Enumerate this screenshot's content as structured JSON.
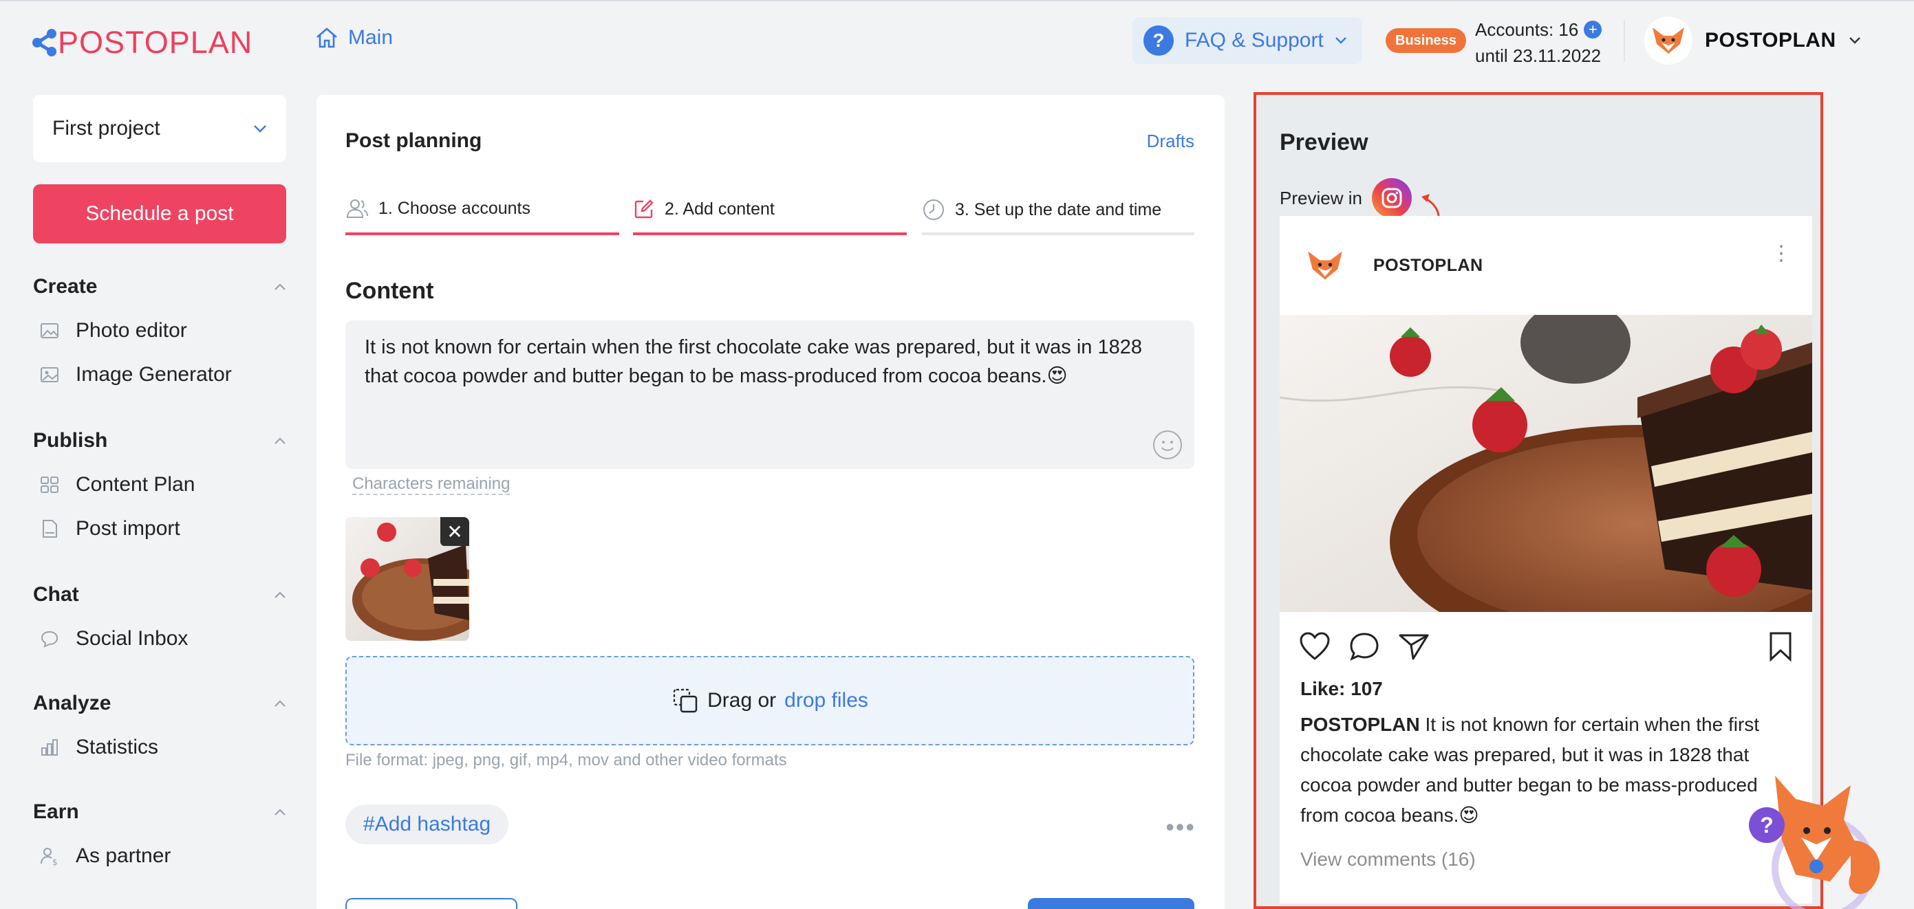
{
  "header": {
    "logo": "POSTOPLAN",
    "main_link": "Main",
    "faq": "FAQ & Support",
    "badge": "Business",
    "accounts_label": "Accounts: 16",
    "accounts_until": "until 23.11.2022",
    "user_name": "POSTOPLAN"
  },
  "sidebar": {
    "project": "First project",
    "schedule_button": "Schedule a post",
    "sections": [
      {
        "title": "Create",
        "items": [
          "Photo editor",
          "Image Generator"
        ]
      },
      {
        "title": "Publish",
        "items": [
          "Content Plan",
          "Post import"
        ]
      },
      {
        "title": "Chat",
        "items": [
          "Social Inbox"
        ]
      },
      {
        "title": "Analyze",
        "items": [
          "Statistics"
        ]
      },
      {
        "title": "Earn",
        "items": [
          "As partner"
        ]
      }
    ]
  },
  "planner": {
    "title": "Post planning",
    "drafts": "Drafts",
    "steps": [
      "1. Choose accounts",
      "2. Add content",
      "3. Set up the date and time"
    ],
    "content_title": "Content",
    "text": "It is not known for certain when the first chocolate cake was prepared, but it was in 1828 that cocoa powder and butter began to be mass-produced from cocoa beans.😍",
    "chars_remaining": "Characters remaining",
    "drop_text": "Drag or",
    "drop_link": "drop files",
    "formats": "File format: jpeg, png, gif, mp4, mov and other video formats",
    "hashtag": "#Add hashtag"
  },
  "preview": {
    "title": "Preview",
    "preview_in": "Preview in",
    "account": "POSTOPLAN",
    "likes": "Like: 107",
    "caption_user": "POSTOPLAN",
    "caption_text": " It is not known for certain when the first chocolate cake was prepared, but it was in 1828 that cocoa powder and butter began to be mass-produced from cocoa beans.😍",
    "view_comments": "View comments (16)"
  },
  "colors": {
    "brand": "#ee3f5d",
    "accent": "#3b7ae0",
    "highlight": "#e8412e",
    "badge": "#f0743a"
  }
}
